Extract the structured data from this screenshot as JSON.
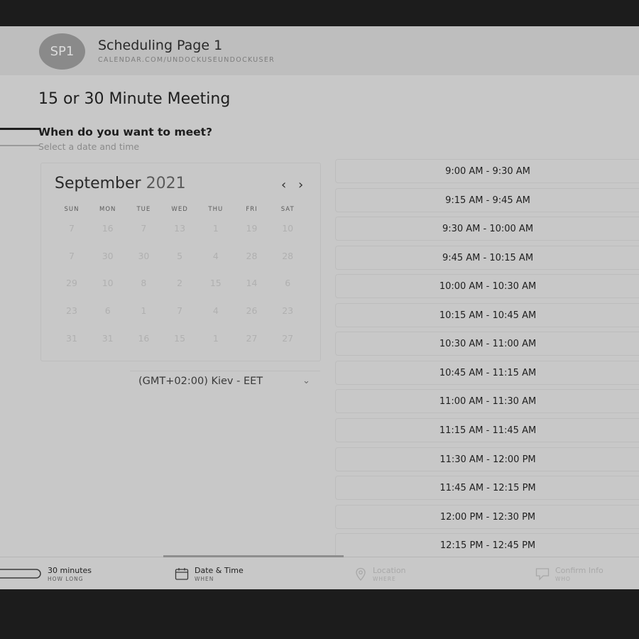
{
  "header": {
    "avatar_initials": "SP1",
    "page_name": "Scheduling Page 1",
    "page_url": "CALENDAR.COM/UNDOCKUSEUNDOCKUSER"
  },
  "meeting": {
    "title": "15 or 30 Minute Meeting",
    "prompt_title": "When do you want to meet?",
    "prompt_subtitle": "Select a date and time"
  },
  "calendar": {
    "month": "September",
    "year": "2021",
    "prev_icon": "chevron-left-icon",
    "next_icon": "chevron-right-icon",
    "weekdays": [
      "SUN",
      "MON",
      "TUE",
      "WED",
      "THU",
      "FRI",
      "SAT"
    ],
    "weeks": [
      [
        "7",
        "16",
        "7",
        "13",
        "1",
        "19",
        "10"
      ],
      [
        "7",
        "30",
        "30",
        "5",
        "4",
        "28",
        "28"
      ],
      [
        "29",
        "10",
        "8",
        "2",
        "15",
        "14",
        "6"
      ],
      [
        "23",
        "6",
        "1",
        "7",
        "4",
        "26",
        "23"
      ],
      [
        "31",
        "31",
        "16",
        "15",
        "1",
        "27",
        "27"
      ]
    ]
  },
  "timezone": {
    "label": "(GMT+02:00) Kiev - EET",
    "icon": "chevron-down-icon"
  },
  "slots": [
    "9:00 AM - 9:30 AM",
    "9:15 AM - 9:45 AM",
    "9:30 AM - 10:00 AM",
    "9:45 AM - 10:15 AM",
    "10:00 AM - 10:30 AM",
    "10:15 AM - 10:45 AM",
    "10:30 AM - 11:00 AM",
    "10:45 AM - 11:15 AM",
    "11:00 AM - 11:30 AM",
    "11:15 AM - 11:45 AM",
    "11:30 AM - 12:00 PM",
    "11:45 AM - 12:15 PM",
    "12:00 PM - 12:30 PM",
    "12:15 PM - 12:45 PM"
  ],
  "steps": [
    {
      "title": "30 minutes",
      "subtitle": "HOW LONG",
      "icon": "duration-icon",
      "state": "done"
    },
    {
      "title": "Date & Time",
      "subtitle": "WHEN",
      "icon": "calendar-icon",
      "state": "active"
    },
    {
      "title": "Location",
      "subtitle": "WHERE",
      "icon": "location-pin-icon",
      "state": "disabled"
    },
    {
      "title": "Confirm Info",
      "subtitle": "WHO",
      "icon": "chat-icon",
      "state": "disabled"
    }
  ],
  "colors": {
    "background": "#c8c8c8",
    "frame": "#1c1c1c",
    "avatar": "#8a8a8a"
  }
}
